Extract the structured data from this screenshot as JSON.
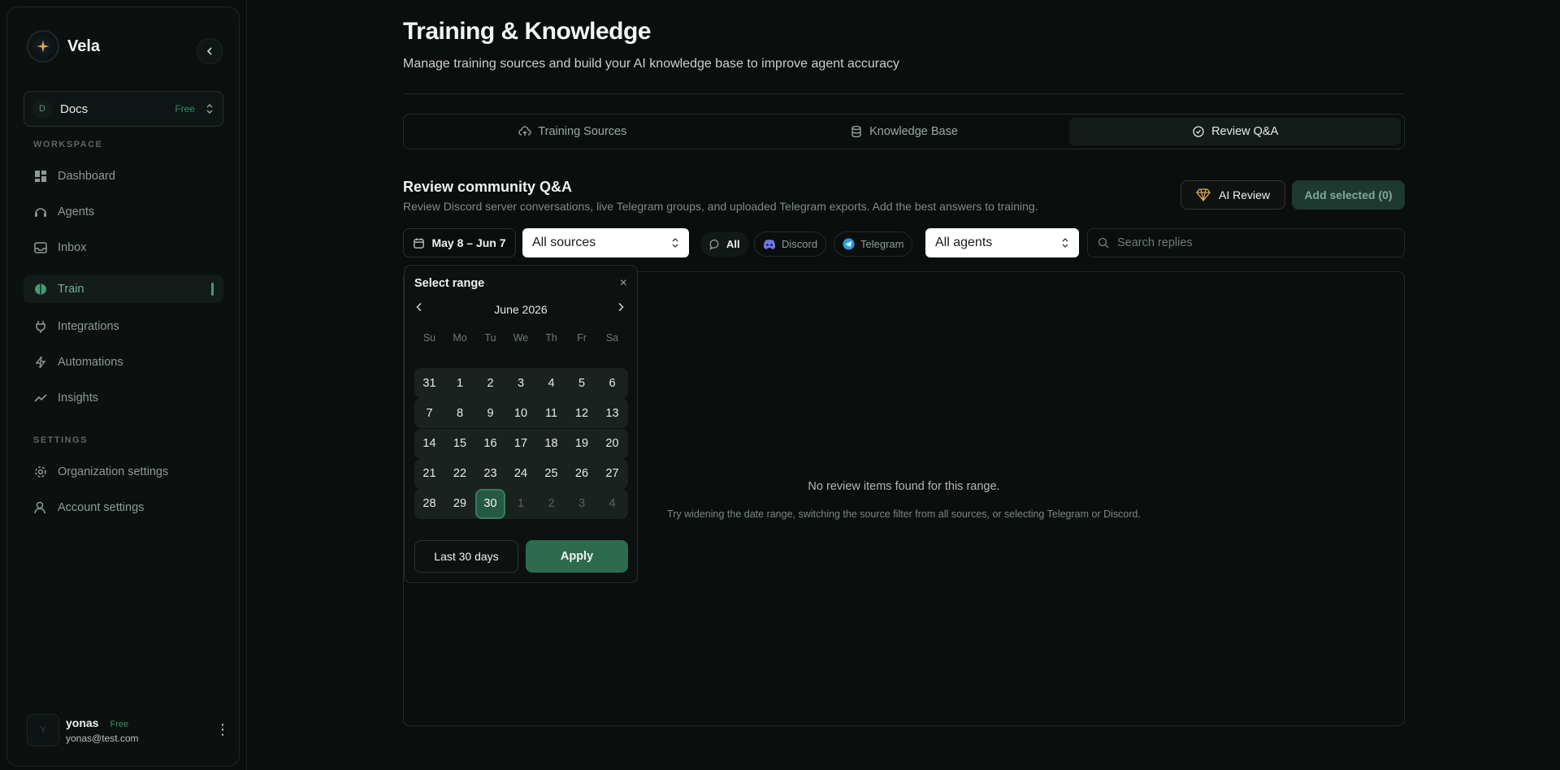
{
  "app": {
    "name": "Vela"
  },
  "workspace": {
    "initial": "D",
    "name": "Docs",
    "plan": "Free"
  },
  "sidebar": {
    "workspace_label": "WORKSPACE",
    "settings_label": "SETTINGS",
    "items": [
      {
        "label": "Dashboard",
        "icon": "dashboard-icon"
      },
      {
        "label": "Agents",
        "icon": "agents-icon"
      },
      {
        "label": "Inbox",
        "icon": "inbox-icon"
      },
      {
        "label": "Train",
        "icon": "brain-icon",
        "active": true
      },
      {
        "label": "Integrations",
        "icon": "plug-icon"
      },
      {
        "label": "Automations",
        "icon": "bolt-icon"
      },
      {
        "label": "Insights",
        "icon": "trend-icon"
      }
    ],
    "settings_items": [
      {
        "label": "Organization settings",
        "icon": "gear-icon"
      },
      {
        "label": "Account settings",
        "icon": "user-icon"
      }
    ]
  },
  "user": {
    "initial": "Y",
    "name": "yonas",
    "plan": "Free",
    "email": "yonas@test.com"
  },
  "page": {
    "title": "Training & Knowledge",
    "subtitle": "Manage training sources and build your AI knowledge base to improve agent accuracy"
  },
  "tabs": [
    {
      "label": "Training Sources"
    },
    {
      "label": "Knowledge Base"
    },
    {
      "label": "Review Q&A",
      "active": true
    }
  ],
  "review": {
    "title": "Review community Q&A",
    "subtitle": "Review Discord server conversations, live Telegram groups, and uploaded Telegram exports. Add the best answers to training.",
    "ai_review_label": "AI Review",
    "add_selected_label": "Add selected (0)"
  },
  "filters": {
    "date_range": "May 8 – Jun 7",
    "source_select": "All sources",
    "chips": [
      "All",
      "Discord",
      "Telegram"
    ],
    "agent_select": "All agents",
    "search_placeholder": "Search replies"
  },
  "empty": {
    "title": "No review items found for this range.",
    "hint": "Try widening the date range, switching the source filter from all sources, or selecting Telegram or Discord."
  },
  "calendar": {
    "title": "Select range",
    "close": "×",
    "month": "June 2026",
    "weekdays": [
      "Su",
      "Mo",
      "Tu",
      "We",
      "Th",
      "Fr",
      "Sa"
    ],
    "weeks": [
      [
        "31",
        "1",
        "2",
        "3",
        "4",
        "5",
        "6"
      ],
      [
        "7",
        "8",
        "9",
        "10",
        "11",
        "12",
        "13"
      ],
      [
        "14",
        "15",
        "16",
        "17",
        "18",
        "19",
        "20"
      ],
      [
        "21",
        "22",
        "23",
        "24",
        "25",
        "26",
        "27"
      ],
      [
        "28",
        "29",
        "30",
        "1",
        "2",
        "3",
        "4"
      ]
    ],
    "selected_day": "30",
    "last30_label": "Last 30 days",
    "apply_label": "Apply"
  },
  "colors": {
    "accent": "#2d6a4f",
    "accent_text": "#6bb391",
    "background": "#0a0e0d"
  }
}
